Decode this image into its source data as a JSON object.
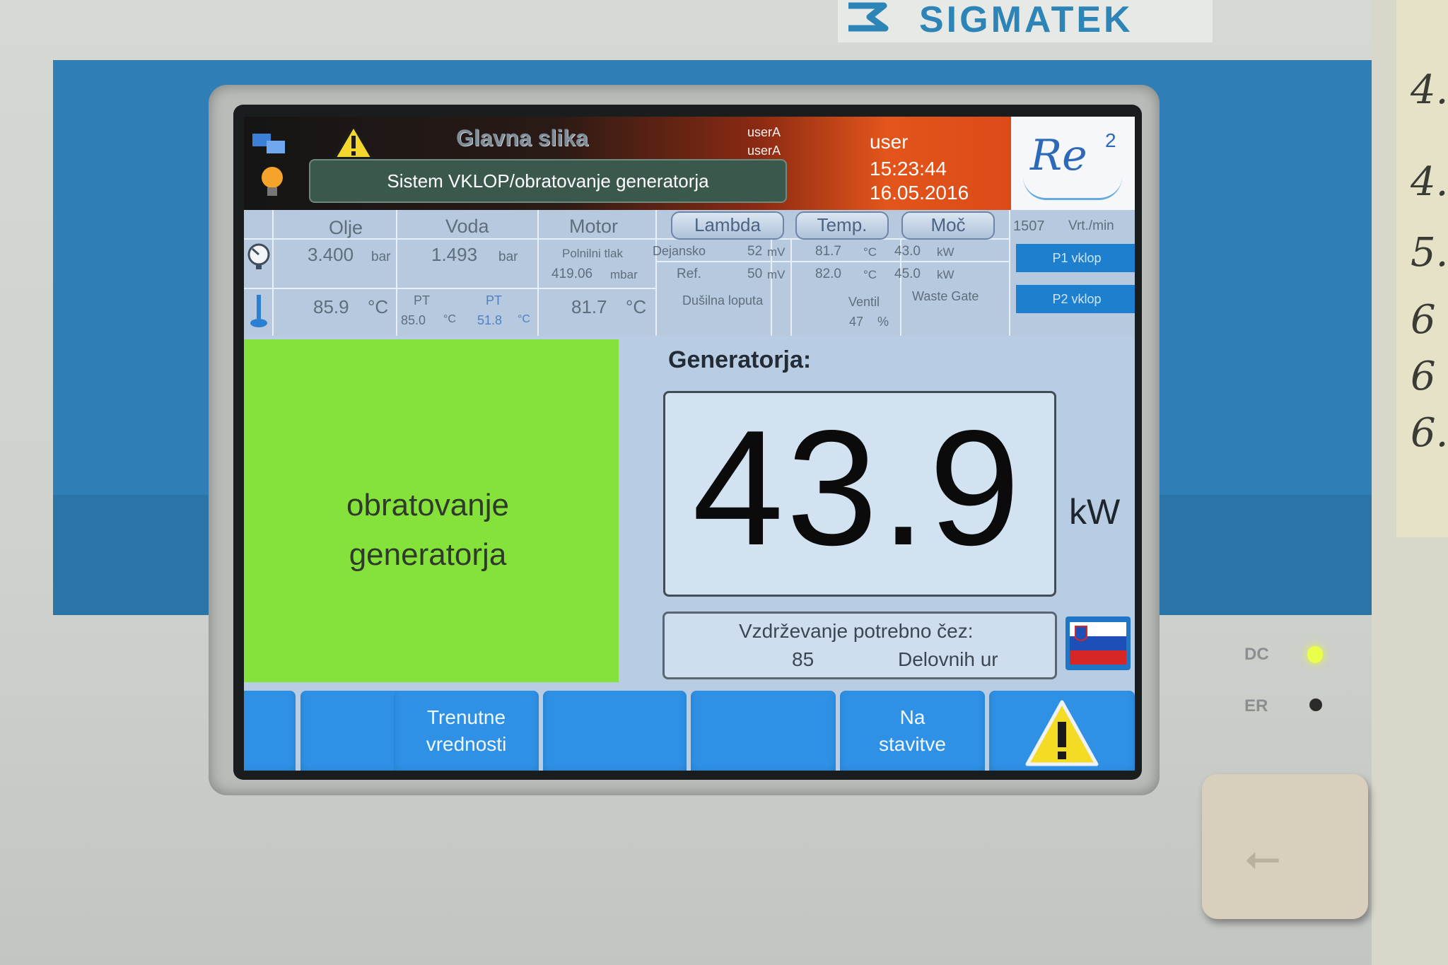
{
  "device": {
    "brand": "SIGMATEK",
    "led_dc_label": "DC",
    "led_er_label": "ER",
    "handwritten_notes": [
      "4.",
      "4.",
      "5.",
      "6",
      "6",
      "6."
    ]
  },
  "header": {
    "title": "Glavna slika",
    "user_a_1": "userA",
    "user_a_2": "userA",
    "user": "user",
    "time": "15:23:44",
    "date": "16.05.2016",
    "status_message": "Sistem VKLOP/obratovanje generatorja",
    "logo_text": "Re",
    "logo_superscript": "2"
  },
  "params": {
    "oil": {
      "label": "Olje",
      "pressure": "3.400",
      "pressure_unit": "bar",
      "temp": "85.9",
      "temp_unit": "°C"
    },
    "water": {
      "label": "Voda",
      "pressure": "1.493",
      "pressure_unit": "bar",
      "pt1_label": "PT",
      "pt1_value": "85.0",
      "pt1_unit": "°C",
      "pt2_label": "PT",
      "pt2_value": "51.8",
      "pt2_unit": "°C"
    },
    "motor": {
      "label": "Motor",
      "boost_label": "Polnilni tlak",
      "boost_value": "419.06",
      "boost_unit": "mbar",
      "temp": "81.7",
      "temp_unit": "°C"
    },
    "lambda": {
      "button": "Lambda",
      "actual_label": "Dejansko",
      "actual_value": "52",
      "actual_unit": "mV",
      "ref_label": "Ref.",
      "ref_value": "50",
      "ref_unit": "mV",
      "throttle_label": "Dušilna loputa"
    },
    "temp": {
      "button": "Temp.",
      "actual_value": "81.7",
      "actual_unit": "°C",
      "ref_value": "82.0",
      "ref_unit": "°C",
      "valve_label": "Ventil",
      "valve_value": "47",
      "valve_unit": "%"
    },
    "power": {
      "button": "Moč",
      "actual_value": "43.0",
      "actual_unit": "kW",
      "ref_value": "45.0",
      "ref_unit": "kW",
      "wastegate_label": "Waste Gate"
    },
    "rpm": {
      "value": "1507",
      "unit": "Vrt./min"
    },
    "pump1": "P1 vklop",
    "pump2": "P2 vklop"
  },
  "main": {
    "state_line1": "obratovanje",
    "state_line2": "generatorja",
    "generator_label": "Generatorja:",
    "power_value": "43.9",
    "power_unit": "kW",
    "maintenance_label": "Vzdrževanje potrebno čez:",
    "maintenance_hours": "85",
    "maintenance_unit": "Delovnih ur"
  },
  "function_keys": {
    "f2_line1": "Trenutne",
    "f2_line2": "vrednosti",
    "f5_line1": "Na",
    "f5_line2": "stavitve"
  },
  "colors": {
    "state_green": "#85e23a",
    "button_blue": "#2f91e6",
    "header_orange": "#e2551b",
    "brand_blue": "#2d84b6"
  }
}
